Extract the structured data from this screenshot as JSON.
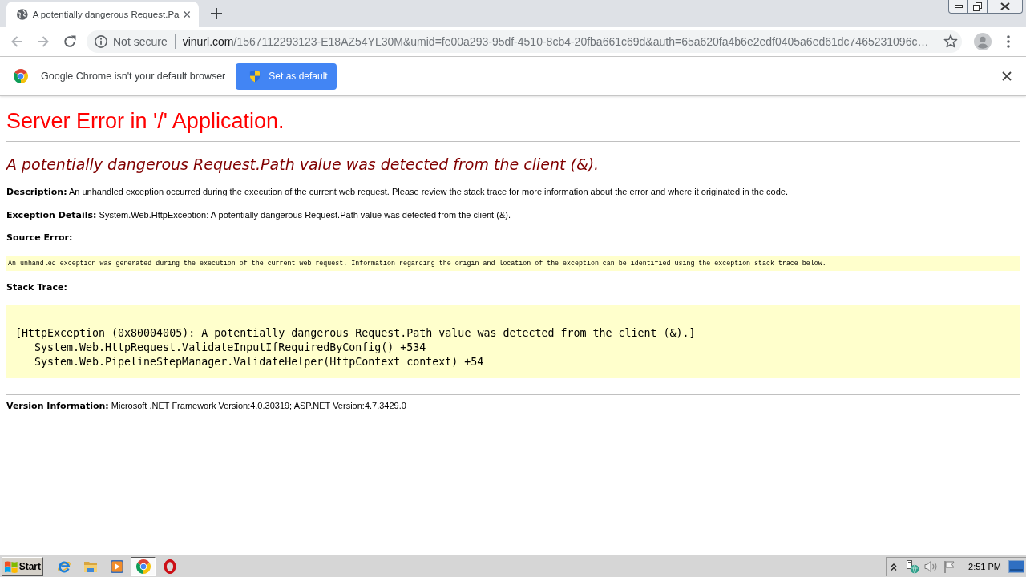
{
  "browser": {
    "tab": {
      "title": "A potentially dangerous Request.Pa",
      "selected": true
    },
    "back": {
      "disabled": true
    },
    "forward": {
      "disabled": true
    },
    "address": {
      "security": "Not secure",
      "host": "vinurl.com",
      "path": "/1567112293123-E18AZ54YL30M&umid=fe00a293-95df-4510-8cb4-20fba661c69d&auth=65a620fa4b6e2edf0405a6ed61dc7465231096c…"
    },
    "infobar": {
      "message": "Google Chrome isn't your default browser",
      "button": "Set as default"
    }
  },
  "page": {
    "title": "Server Error in '/' Application.",
    "heading": "A potentially dangerous Request.Path value was detected from the client (&).",
    "description": "**Description:** An unhandled exception occurred during the execution of the current web request. Please review the stack trace for more information about the error and where it originated in the code.",
    "exception_details": "**Exception Details:** System.Web.HttpException: A potentially dangerous Request.Path value was detected from the client (&).",
    "source_error": {
      "label": "Source Error:",
      "text": "An unhandled exception was generated during the execution of the current web request. Information regarding the origin and location of the exception can be identified using the exception stack trace below."
    },
    "stack_trace": {
      "label": "Stack Trace:",
      "exception": "[HttpException (0x80004005): A potentially dangerous Request.Path value was detected from the client (&).]",
      "frames": [
        "System.Web.HttpRequest.ValidateInputIfRequiredByConfig() +534",
        "System.Web.PipelineStepManager.ValidateHelper(HttpContext context) +54"
      ]
    },
    "version_information": "**Version Information:** Microsoft .NET Framework Version:4.0.30319; ASP.NET Version:4.7.3429.0"
  },
  "taskbar": {
    "start": "Start",
    "apps": [
      {
        "selected": false
      },
      {
        "selected": false
      },
      {
        "selected": false
      },
      {
        "selected": true
      },
      {
        "selected": false
      }
    ],
    "clock": "2:51 PM"
  }
}
